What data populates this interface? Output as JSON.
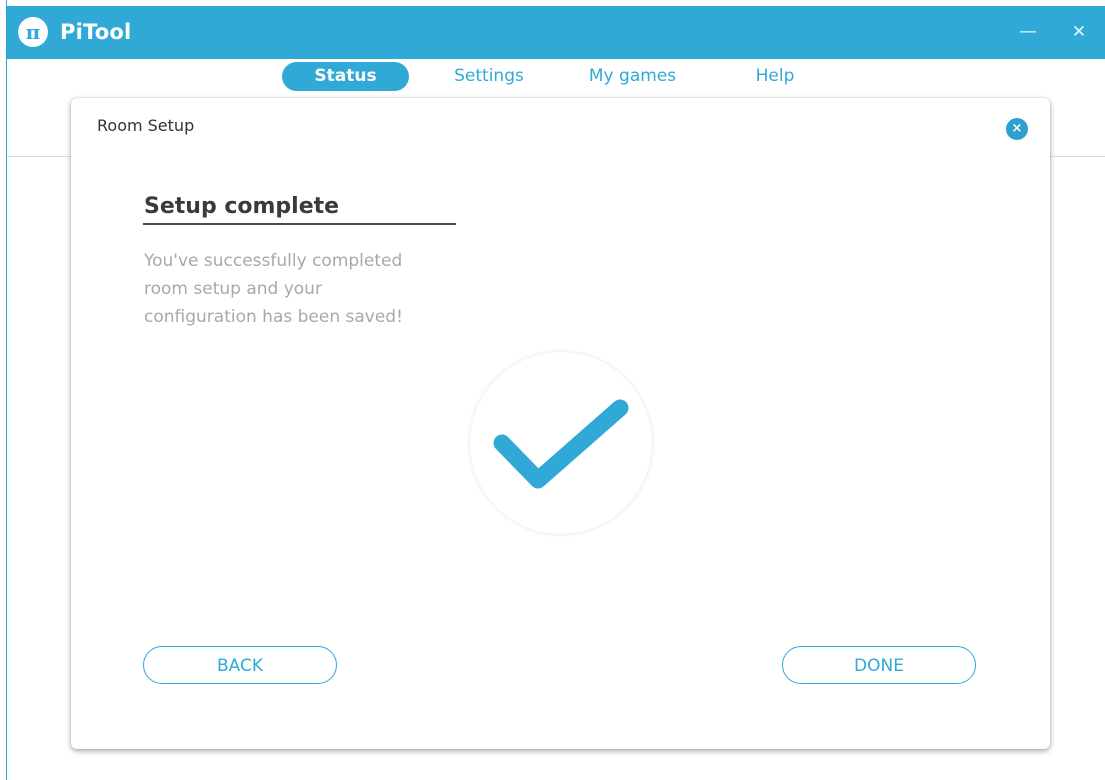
{
  "app": {
    "title": "PiTool",
    "logo_text": "π",
    "window_controls": {
      "minimize": "—",
      "close": "✕"
    }
  },
  "tabs": [
    {
      "label": "Status",
      "active": true
    },
    {
      "label": "Settings",
      "active": false
    },
    {
      "label": "My games",
      "active": false
    },
    {
      "label": "Help",
      "active": false
    }
  ],
  "dialog": {
    "title": "Room Setup",
    "close_icon": "×",
    "heading": "Setup complete",
    "description": "You've successfully completed room setup and your configuration has been saved!",
    "status_icon": "checkmark-icon",
    "back_label": "BACK",
    "done_label": "DONE"
  },
  "colors": {
    "accent": "#31a9d7",
    "heading": "#3a3a3a",
    "muted_text": "#a8a8a8"
  }
}
